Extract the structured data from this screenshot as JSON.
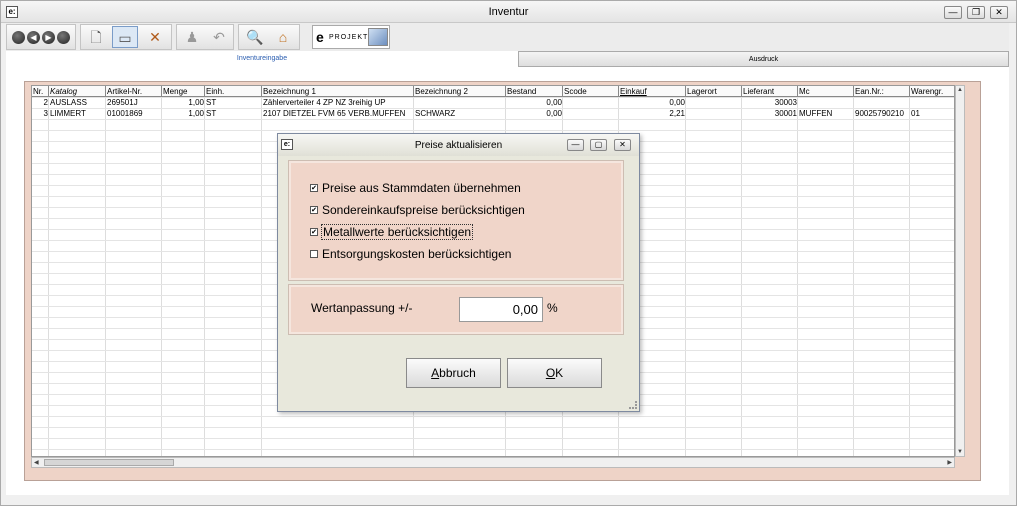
{
  "window": {
    "title": "Inventur",
    "icon_text": "e:"
  },
  "toolbar": {
    "nav_prev": "◀",
    "nav_next": "▶",
    "project_e": "e",
    "project_text": "PROJEKT:"
  },
  "tabs": [
    {
      "label": "Inventureingabe"
    },
    {
      "label": "Ausdruck"
    }
  ],
  "table": {
    "columns": [
      "Nr.",
      "Katalog",
      "Artikel-Nr.",
      "Menge",
      "Einh.",
      "Bezeichnung 1",
      "Bezeichnung 2",
      "Bestand",
      "Scode",
      "Einkauf",
      "Lagerort",
      "Lieferant",
      "Mc",
      "Ean.Nr.:",
      "Warengr."
    ],
    "rows": [
      [
        "2",
        "AUSLASS",
        "269501J",
        "1,00",
        "ST",
        "Zählerverteiler 4 ZP NZ 3reihig UP",
        "",
        "0,00",
        "",
        "0,00",
        "",
        "30003",
        "",
        "",
        ""
      ],
      [
        "3",
        "LIMMERT",
        "01001869",
        "1,00",
        "ST",
        "2107 DIETZEL FVM 65 VERB.MUFFEN",
        "SCHWARZ",
        "0,00",
        "",
        "2,21",
        "",
        "30001",
        "MUFFEN",
        "90025790210",
        "01"
      ]
    ]
  },
  "dialog": {
    "title": "Preise aktualisieren",
    "icon_text": "e:",
    "checkboxes": [
      {
        "label": "Preise aus Stammdaten übernehmen",
        "checked": true
      },
      {
        "label": "Sondereinkaufspreise berücksichtigen",
        "checked": true
      },
      {
        "label": "Metallwerte berücksichtigen",
        "checked": true
      },
      {
        "label": "Entsorgungskosten berücksichtigen",
        "checked": false
      }
    ],
    "wert_label": "Wertanpassung  +/-",
    "wert_value": "0,00",
    "wert_unit": "%",
    "cancel_label": "Abbruch",
    "ok_label": "OK"
  }
}
